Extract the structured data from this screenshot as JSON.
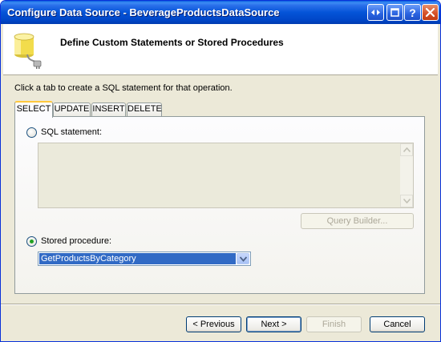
{
  "window": {
    "title": "Configure Data Source - BeverageProductsDataSource"
  },
  "header": {
    "title": "Define Custom Statements or Stored Procedures",
    "icon": "database-plug-icon"
  },
  "instruction": "Click a tab to create a SQL statement for that operation.",
  "tabs": [
    {
      "label": "SELECT",
      "active": true
    },
    {
      "label": "UPDATE",
      "active": false
    },
    {
      "label": "INSERT",
      "active": false
    },
    {
      "label": "DELETE",
      "active": false
    }
  ],
  "panel": {
    "sql_statement_label": "SQL statement:",
    "sql_statement_value": "",
    "query_builder_label": "Query Builder...",
    "stored_procedure_label": "Stored procedure:",
    "stored_procedure_value": "GetProductsByCategory",
    "selected_option": "stored_procedure"
  },
  "buttons": {
    "previous": "< Previous",
    "next": "Next >",
    "finish": "Finish",
    "cancel": "Cancel"
  },
  "colors": {
    "titlebar": "#0454d8",
    "selection": "#316ac5",
    "tab_highlight": "#ffc83c",
    "radio_dot": "#21a121"
  }
}
